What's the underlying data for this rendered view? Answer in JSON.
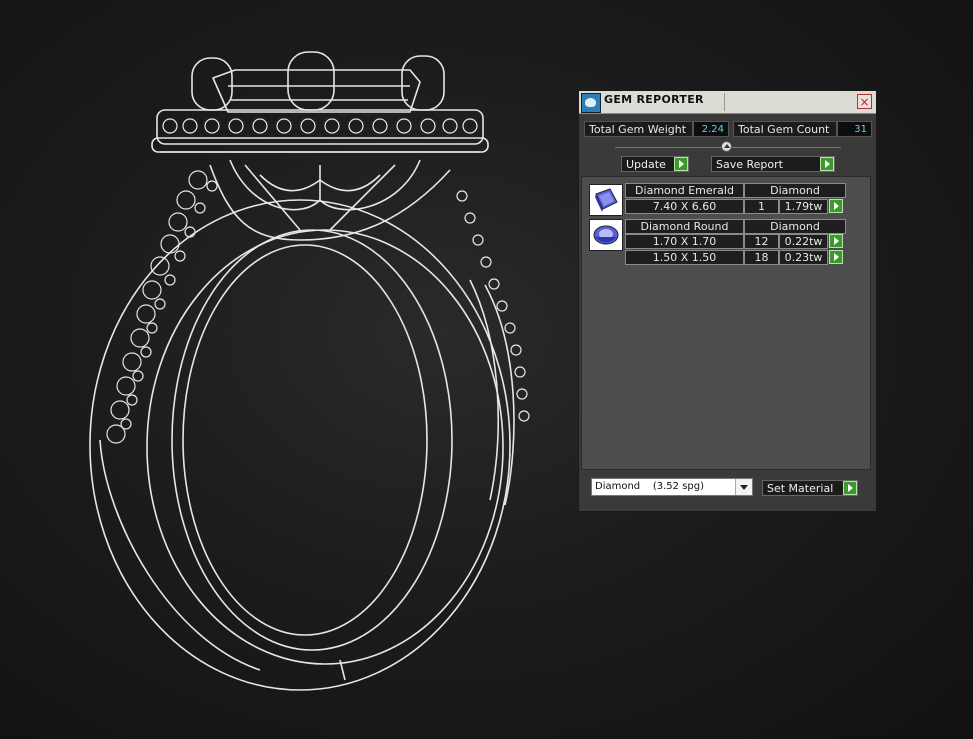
{
  "panel": {
    "title": "GEM REPORTER",
    "close_symbol": "×",
    "stats": {
      "weight_label": "Total Gem Weight",
      "weight_value": "2.24",
      "count_label": "Total Gem Count",
      "count_value": "31"
    },
    "buttons": {
      "update": "Update",
      "save_report": "Save Report",
      "set_material": "Set Material"
    },
    "material": {
      "selected": "Diamond    (3.52 spg)"
    },
    "gems": [
      {
        "icon": "emerald-cut-gem-icon",
        "shape": "Diamond Emerald",
        "material": "Diamond",
        "rows": [
          {
            "size": "7.40 X 6.60",
            "count": "1",
            "weight": "1.79tw"
          }
        ]
      },
      {
        "icon": "round-gem-icon",
        "shape": "Diamond Round",
        "material": "Diamond",
        "rows": [
          {
            "size": "1.70 X 1.70",
            "count": "12",
            "weight": "0.22tw"
          },
          {
            "size": "1.50 X 1.50",
            "count": "18",
            "weight": "0.23tw"
          }
        ]
      }
    ]
  },
  "colors": {
    "background": "#1c1c1c",
    "panel": "#3a3a3a",
    "stat_value": "#5fd0ff",
    "go_button": "#3a9a2a",
    "wireframe": "#e6e6e6"
  }
}
